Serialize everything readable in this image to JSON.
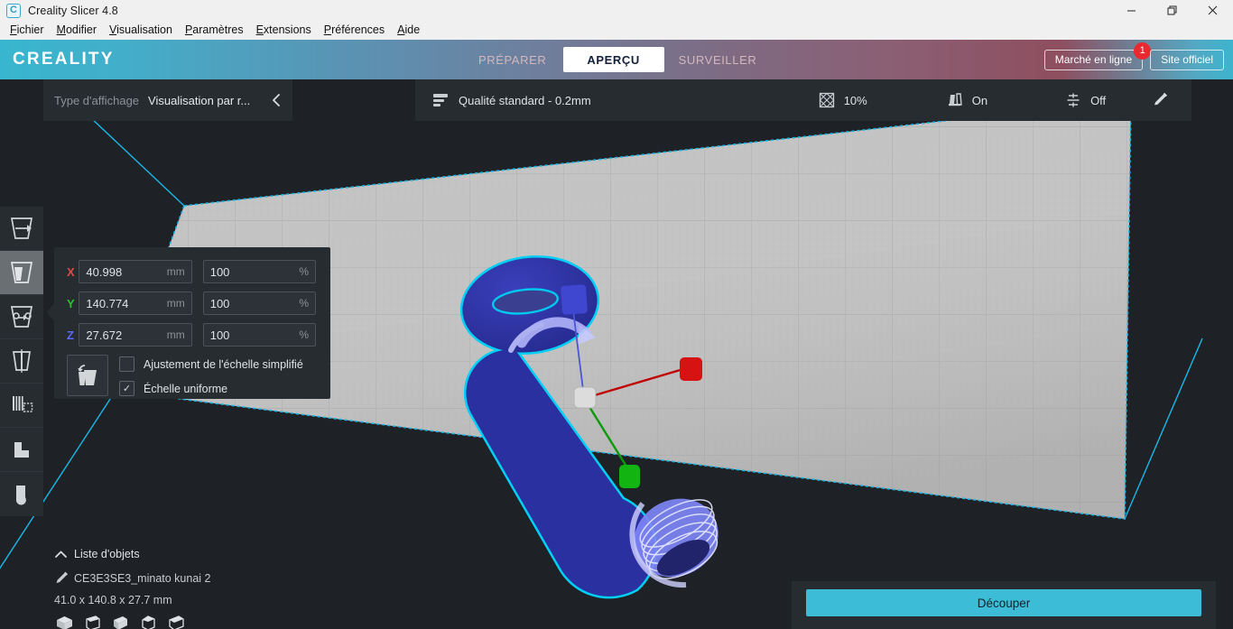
{
  "window": {
    "title": "Creality Slicer 4.8",
    "app_icon": "creality-logo-icon",
    "controls": {
      "minimize": "—",
      "restore": "❐",
      "close": "✕"
    }
  },
  "menubar": {
    "items": [
      {
        "mnemonic": "F",
        "rest": "ichier"
      },
      {
        "mnemonic": "M",
        "rest": "odifier"
      },
      {
        "mnemonic": "V",
        "rest": "isualisation"
      },
      {
        "mnemonic": "P",
        "rest": "aramètres"
      },
      {
        "mnemonic": "E",
        "rest": "xtensions"
      },
      {
        "mnemonic": "P",
        "rest": "références"
      },
      {
        "mnemonic": "A",
        "rest": "ide"
      }
    ]
  },
  "header": {
    "brand": "CREALITY",
    "tabs": [
      {
        "label": "PRÉPARER",
        "active": false
      },
      {
        "label": "APERÇU",
        "active": true
      },
      {
        "label": "SURVEILLER",
        "active": false
      }
    ],
    "marketplace_button": "Marché en ligne",
    "marketplace_badge": "1",
    "official_site_button": "Site officiel"
  },
  "view_type": {
    "label": "Type d'affichage",
    "value": "Visualisation par r...",
    "chevron": "‹"
  },
  "print_setup": {
    "quality": "Qualité standard - 0.2mm",
    "infill": "10%",
    "support": "On",
    "adhesion": "Off",
    "edit_icon": "pencil-icon"
  },
  "left_toolbar": {
    "tools": [
      {
        "name": "move-tool",
        "active": false
      },
      {
        "name": "scale-tool",
        "active": true
      },
      {
        "name": "rotate-tool",
        "active": false
      },
      {
        "name": "mirror-tool",
        "active": false
      },
      {
        "name": "per-model-settings-tool",
        "active": false
      },
      {
        "name": "support-blocker-tool",
        "active": false
      },
      {
        "name": "custom-supports-tool",
        "active": false
      }
    ]
  },
  "scale_panel": {
    "axes": [
      {
        "axis": "X",
        "value": "40.998",
        "unit": "mm",
        "percent": "100",
        "pct_unit": "%"
      },
      {
        "axis": "Y",
        "value": "140.774",
        "unit": "mm",
        "percent": "100",
        "pct_unit": "%"
      },
      {
        "axis": "Z",
        "value": "27.672",
        "unit": "mm",
        "percent": "100",
        "pct_unit": "%"
      }
    ],
    "snap_scaling_label": "Ajustement de l'échelle simplifié",
    "snap_scaling_checked": false,
    "uniform_scaling_label": "Échelle uniforme",
    "uniform_scaling_checked": true,
    "uniform_check_glyph": "✓"
  },
  "object_list": {
    "header": "Liste d'objets",
    "collapse_chevron": "⌃",
    "item_name": "CE3E3SE3_minato kunai 2",
    "dimensions": "41.0 x 140.8 x 27.7 mm",
    "view_icons": [
      "view-iso-icon",
      "view-front-icon",
      "view-top-icon",
      "view-left-icon",
      "view-right-icon"
    ]
  },
  "slice_panel": {
    "button_label": "Découper"
  },
  "colors": {
    "accent_cyan": "#3cbcd6",
    "panel_bg": "#272c31",
    "viewport_bg": "#1e2226",
    "model_fill": "#2a2f9e",
    "model_outline": "#00c8f0",
    "axis_x": "#e44a4a",
    "axis_y": "#2fc22f",
    "axis_z": "#5a6bff",
    "badge_red": "#e8292f"
  }
}
